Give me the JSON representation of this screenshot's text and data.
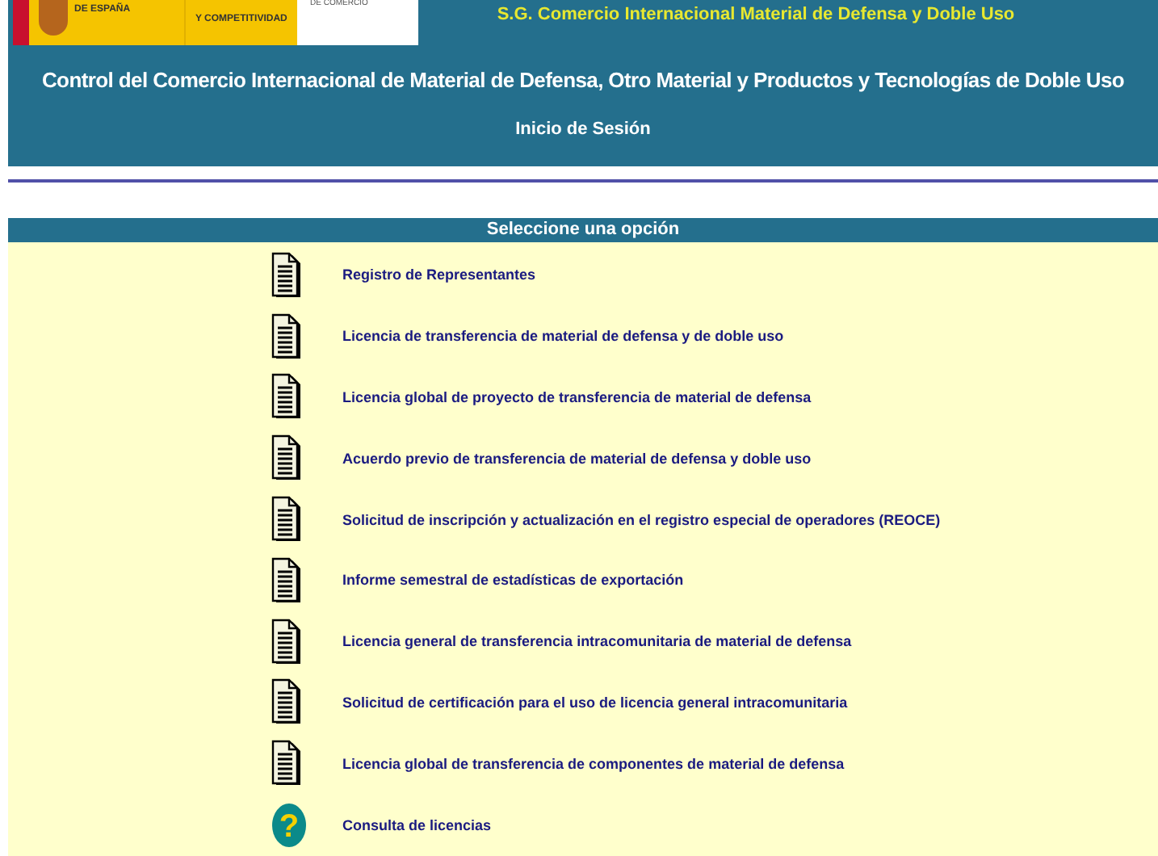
{
  "header": {
    "logos": [
      "DE ESPAÑA",
      "Y COMPETITIVIDAD",
      "DE COMERCIO"
    ],
    "department": "S.G. Comercio Internacional Material de Defensa y Doble Uso",
    "title": "Control del Comercio Internacional de Material de Defensa, Otro Material y Productos y Tecnologías de Doble Uso",
    "subtitle": "Inicio de Sesión"
  },
  "menu": {
    "title": "Seleccione una opción",
    "items": [
      {
        "kind": "document",
        "label": "Registro de Representantes"
      },
      {
        "kind": "document",
        "label": "Licencia de transferencia de material de defensa y de doble uso"
      },
      {
        "kind": "document",
        "label": "Licencia global de proyecto de transferencia de material de defensa"
      },
      {
        "kind": "document",
        "label": "Acuerdo previo de transferencia de material de defensa y doble uso"
      },
      {
        "kind": "document",
        "label": "Solicitud de inscripción y actualización en el registro especial de operadores (REOCE)"
      },
      {
        "kind": "document",
        "label": "Informe semestral de estadísticas de exportación"
      },
      {
        "kind": "document",
        "label": "Licencia general de transferencia intracomunitaria de material de defensa"
      },
      {
        "kind": "document",
        "label": "Solicitud de certificación para el uso de licencia general intracomunitaria"
      },
      {
        "kind": "document",
        "label": "Licencia global de transferencia de componentes de material de defensa"
      },
      {
        "kind": "help",
        "icon": "?",
        "label": "Consulta de licencias"
      }
    ]
  }
}
